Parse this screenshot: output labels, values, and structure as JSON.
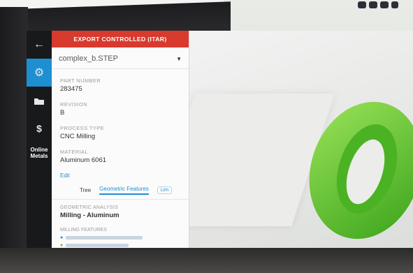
{
  "banner": {
    "label": "EXPORT CONTROLLED (ITAR)"
  },
  "file": {
    "name": "complex_b.STEP"
  },
  "fields": {
    "part_number": {
      "label": "PART NUMBER",
      "value": "283475"
    },
    "revision": {
      "label": "REVISION",
      "value": "B"
    },
    "process_type": {
      "label": "PROCESS TYPE",
      "value": "CNC Milling"
    },
    "material": {
      "label": "MATERIAL",
      "value": "Aluminum 6061"
    }
  },
  "edit_link": "Edit",
  "tabs": {
    "tree": "Tree",
    "geometric": "Geometric Features",
    "extra": "Lim"
  },
  "geometric_analysis": {
    "label": "GEOMETRIC ANALYSIS",
    "value": "Milling - Aluminum"
  },
  "milling_features": {
    "label": "MILLING FEATURES"
  },
  "nav": {
    "brand": "Online Metals"
  },
  "colors": {
    "accent": "#1e8fd1",
    "banner": "#d83a2e",
    "model": "#5cc22b"
  },
  "icons": [
    "back-arrow-icon",
    "gear-icon",
    "folder-icon",
    "dollar-icon",
    "chevron-down-icon",
    "info-icon"
  ]
}
